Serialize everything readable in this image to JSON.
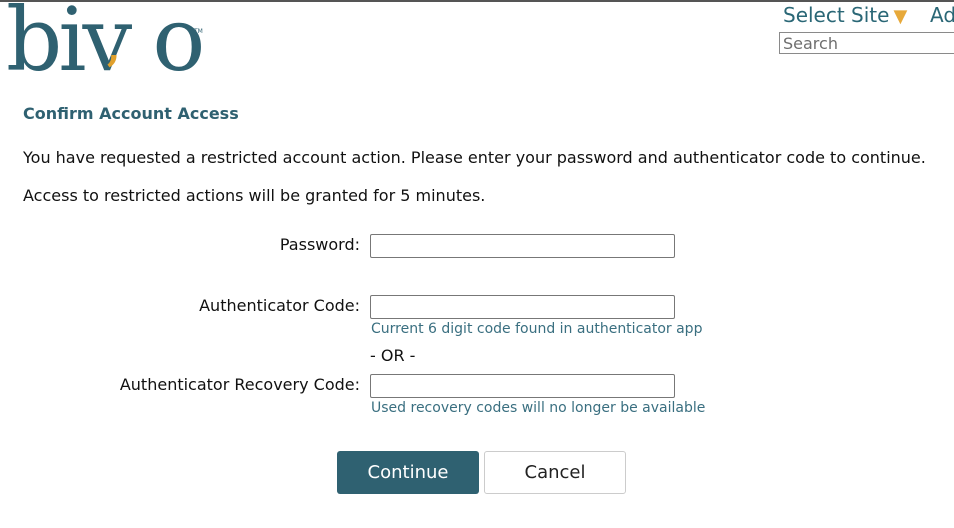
{
  "header": {
    "logo_text": "bivio",
    "site_select_label": "Select Site",
    "site_select_arrow": "▼",
    "add_link_fragment": "Ad",
    "search_placeholder": "Search"
  },
  "page": {
    "heading": "Confirm Account Access",
    "intro": "You have requested a restricted account action. Please enter your password and authenticator code to continue.",
    "grant_note": "Access to restricted actions will be granted for 5 minutes."
  },
  "form": {
    "password_label": "Password:",
    "auth_code_label": "Authenticator Code:",
    "auth_code_hint": "Current 6 digit code found in authenticator app",
    "or_separator": "- OR -",
    "recovery_label": "Authenticator Recovery Code:",
    "recovery_hint": "Used recovery codes will no longer be available",
    "continue_label": "Continue",
    "cancel_label": "Cancel"
  },
  "colors": {
    "brand": "#2f6171",
    "accent": "#e0a02c"
  }
}
